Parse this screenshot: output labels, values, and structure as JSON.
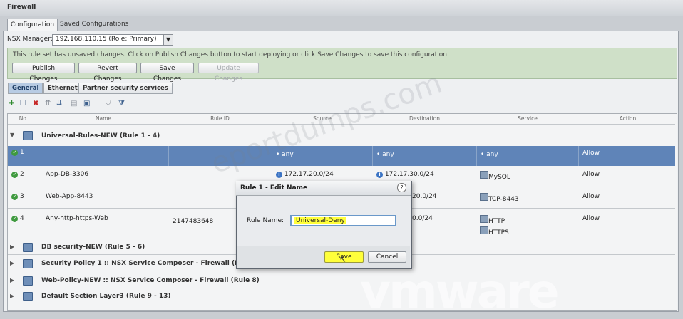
{
  "window": {
    "title": "Firewall"
  },
  "tabs": [
    "Configuration",
    "Saved Configurations"
  ],
  "nsx_manager": {
    "label": "NSX Manager:",
    "value": "192.168.110.15 (Role: Primary)"
  },
  "banner": {
    "message": "This rule set has unsaved changes. Click on Publish Changes button to start deploying or click Save Changes to save this configuration.",
    "buttons": [
      "Publish Changes",
      "Revert Changes",
      "Save Changes",
      "Update Changes"
    ]
  },
  "subtabs": [
    "General",
    "Ethernet",
    "Partner security services"
  ],
  "toolbar_icons": [
    "add-rule-icon",
    "copy-rule-icon",
    "delete-rule-icon",
    "move-up-icon",
    "move-down-icon",
    "add-section-icon",
    "save-section-icon",
    "filter-icon",
    "advanced-filter-icon"
  ],
  "columns": [
    "No.",
    "Name",
    "Rule ID",
    "Source",
    "Destination",
    "Service",
    "Action"
  ],
  "sections": [
    {
      "label": "Universal-Rules-NEW (Rule 1 - 4)"
    },
    {
      "label": "DB security-NEW (Rule 5 - 6)"
    },
    {
      "label": "Security Policy 1 :: NSX Service Composer - Firewall (Rule 7)"
    },
    {
      "label": "Web-Policy-NEW :: NSX Service Composer - Firewall (Rule 8)"
    },
    {
      "label": "Default Section Layer3 (Rule 9 - 13)"
    }
  ],
  "rules": [
    {
      "no": "1",
      "name": "",
      "rule_id": "",
      "source": "any",
      "destination": "any",
      "service": "any",
      "service2": "",
      "action": "Allow"
    },
    {
      "no": "2",
      "name": "App-DB-3306",
      "rule_id": "",
      "source": "172.17.20.0/24",
      "destination": "172.17.30.0/24",
      "service": "MySQL",
      "service2": "",
      "action": "Allow"
    },
    {
      "no": "3",
      "name": "Web-App-8443",
      "rule_id": "",
      "source": "",
      "destination": "20.0/24",
      "service": "TCP-8443",
      "service2": "",
      "action": "Allow"
    },
    {
      "no": "4",
      "name": "Any-http-https-Web",
      "rule_id": "2147483648",
      "source": "",
      "destination": "0.0/24",
      "service": "HTTP",
      "service2": "HTTPS",
      "action": "Allow"
    }
  ],
  "dialog": {
    "title": "Rule 1 - Edit Name",
    "help": "?",
    "field_label": "Rule Name:",
    "field_value": "Universal-Deny",
    "save": "Save",
    "cancel": "Cancel"
  },
  "watermarks": {
    "brand": "vmware",
    "diagonal": "eportdumps.com"
  },
  "colors": {
    "selected_row": "#5f84b8",
    "highlight": "#ffff3a",
    "banner": "#cfe0c8",
    "check": "#3f9a3f"
  }
}
